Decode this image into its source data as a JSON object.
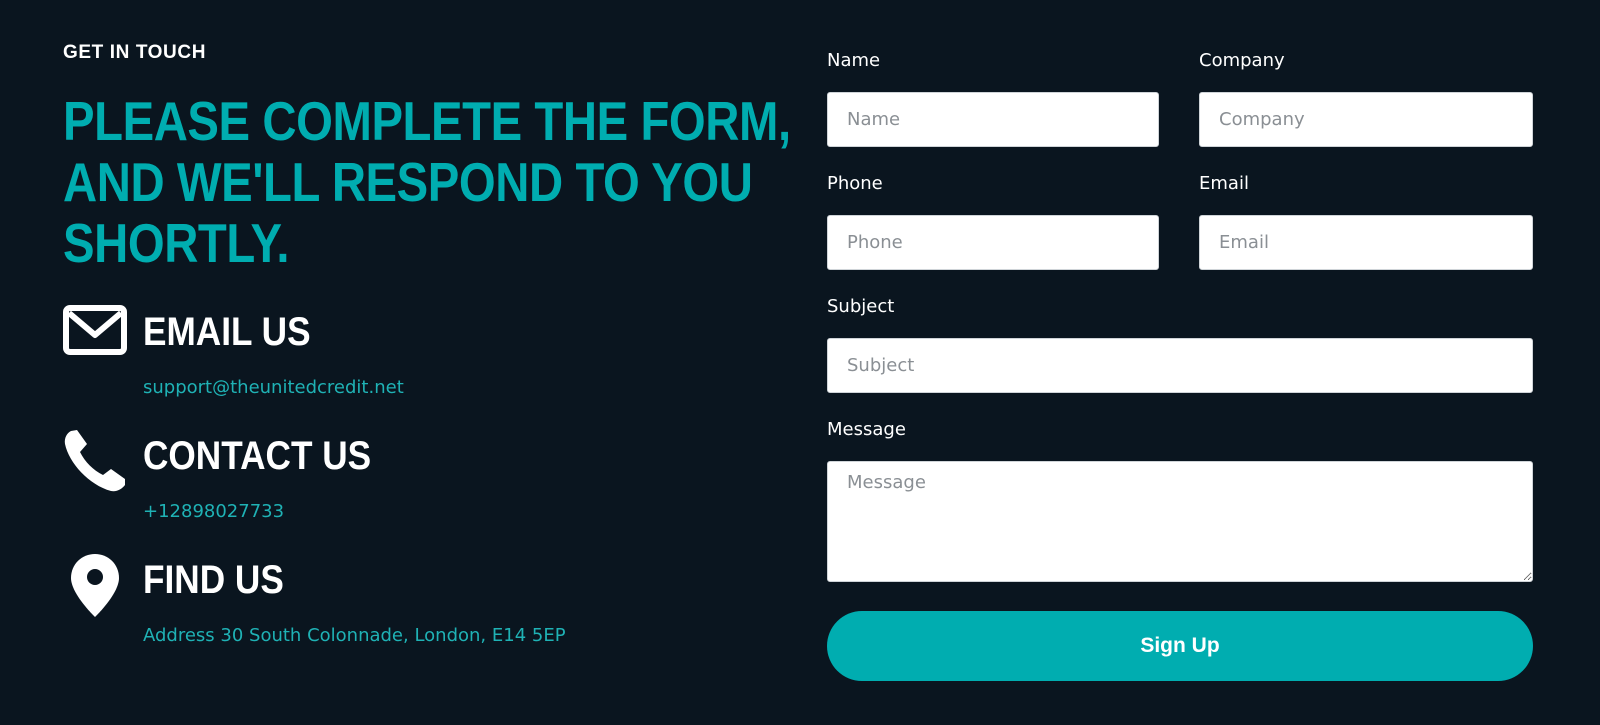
{
  "contact": {
    "eyebrow": "GET IN TOUCH",
    "headline_lines": [
      "PLEASE COMPLETE THE FORM,",
      "AND WE'LL RESPOND TO YOU",
      "SHORTLY."
    ],
    "email": {
      "icon": "envelope-icon",
      "title": "EMAIL US",
      "value": "support@theunitedcredit.net"
    },
    "phone": {
      "icon": "phone-icon",
      "title": "CONTACT US",
      "value": "+12898027733"
    },
    "location": {
      "icon": "map-pin-icon",
      "title": "FIND US",
      "value": "Address 30 South Colonnade, London, E14 5EP"
    }
  },
  "form": {
    "name": {
      "label": "Name",
      "placeholder": "Name",
      "value": ""
    },
    "company": {
      "label": "Company",
      "placeholder": "Company",
      "value": ""
    },
    "phone": {
      "label": "Phone",
      "placeholder": "Phone",
      "value": ""
    },
    "email": {
      "label": "Email",
      "placeholder": "Email",
      "value": ""
    },
    "subject": {
      "label": "Subject",
      "placeholder": "Subject",
      "value": ""
    },
    "message": {
      "label": "Message",
      "placeholder": "Message",
      "value": ""
    },
    "submit_label": "Sign Up"
  },
  "colors": {
    "background": "#0a151f",
    "accent": "#00adb0",
    "text": "#ffffff"
  }
}
